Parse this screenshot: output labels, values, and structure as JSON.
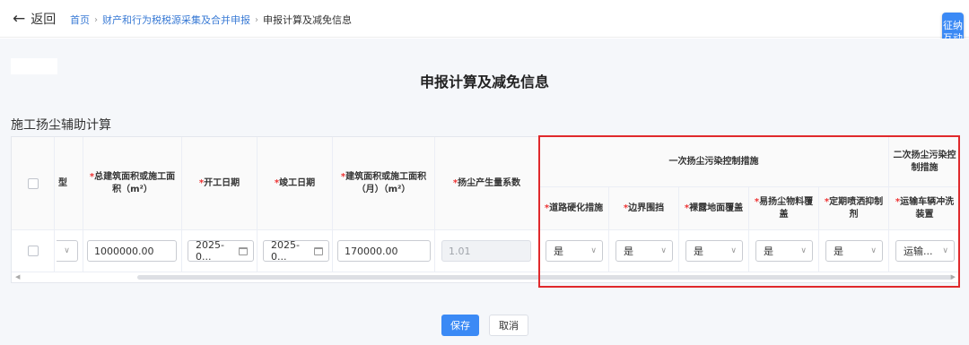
{
  "header": {
    "back_label": "返回",
    "breadcrumb": {
      "home": "首页",
      "parent": "财产和行为税税源采集及合并申报",
      "current": "申报计算及减免信息"
    },
    "side_tab_label": "征纳互动"
  },
  "page": {
    "title": "申报计算及减免信息",
    "section_title": "施工扬尘辅助计算"
  },
  "table": {
    "columns": {
      "type_partial": "型",
      "total_area": "总建筑面积或施工面积（m²）",
      "start_date": "开工日期",
      "end_date": "竣工日期",
      "monthly_area": "建筑面积或施工面积（月）（m²）",
      "dust_coef": "扬尘产生量系数",
      "group_primary": "一次扬尘污染控制措施",
      "road_harden": "道路硬化措施",
      "border_fence": "边界围挡",
      "bare_cover": "裸露地面覆盖",
      "material_cover": "易扬尘物料覆盖",
      "spray": "定期喷洒抑制剂",
      "group_secondary": "二次扬尘污染控制措施",
      "vehicle_wash": "运输车辆冲洗装置"
    },
    "row": {
      "total_area": "1000000.00",
      "start_date": "2025-0...",
      "end_date": "2025-0...",
      "monthly_area": "170000.00",
      "dust_coef": "1.01",
      "road_harden": "是",
      "border_fence": "是",
      "bare_cover": "是",
      "material_cover": "是",
      "spray": "是",
      "vehicle_wash": "运输..."
    }
  },
  "actions": {
    "save": "保存",
    "cancel": "取消"
  },
  "colors": {
    "primary": "#3b8af5",
    "required": "#ee3333",
    "highlight_box": "#e0292c",
    "link": "#3a7bd5"
  }
}
